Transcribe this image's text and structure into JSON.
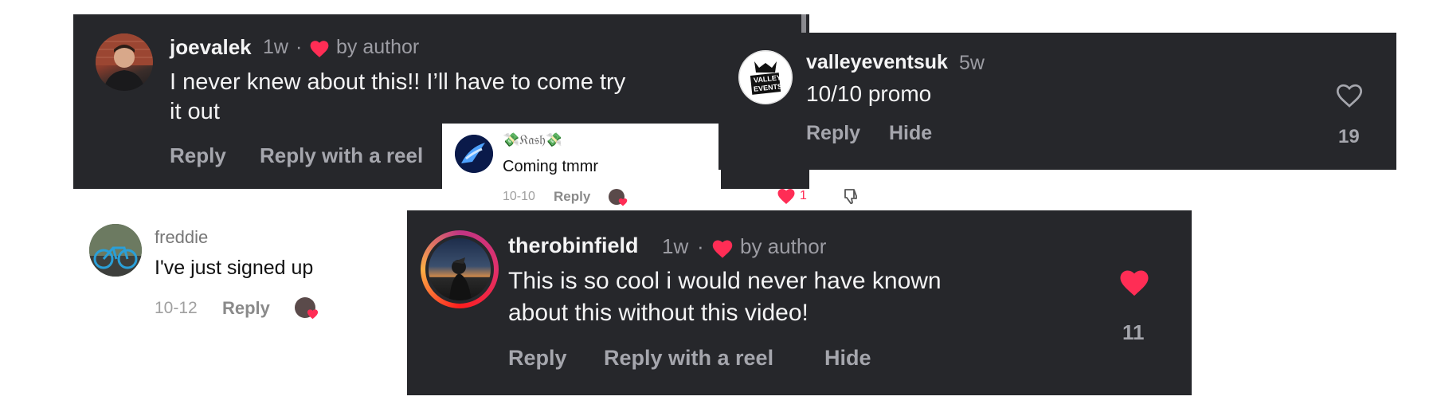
{
  "comments": {
    "joe": {
      "username": "joevalek",
      "time": "1w",
      "separator": "·",
      "author_badge": "by author",
      "text_line1": "I never knew about this!! I’ll have to come try",
      "text_line2": "it out",
      "reply": "Reply",
      "reply_reel": "Reply with a reel",
      "heart_icon": "heart-filled-icon",
      "heart_color": "#ff2d55"
    },
    "kash": {
      "username": "💸𝔎𝔞𝔰𝔥💸",
      "text": "Coming tmmr",
      "date": "10-10",
      "reply": "Reply",
      "like_count": "1",
      "icons": [
        "heart-filled-icon",
        "dislike-icon",
        "creator-liked-avatar"
      ]
    },
    "valley": {
      "username": "valleyeventsuk",
      "time": "5w",
      "text": "10/10 promo",
      "reply": "Reply",
      "hide": "Hide",
      "like_count": "19",
      "avatar_logo_line1": "VALLEY",
      "avatar_logo_line2": "EVENTS",
      "heart_icon": "heart-outline-icon"
    },
    "freddie": {
      "username": "freddie",
      "text": "I've just signed up",
      "date": "10-12",
      "reply": "Reply",
      "icons": [
        "creator-liked-avatar"
      ]
    },
    "robin": {
      "username": "therobinfield",
      "time": "1w",
      "separator": "·",
      "author_badge": "by author",
      "text_line1": "This is so cool i would never have known",
      "text_line2": "about this without this video!",
      "reply": "Reply",
      "reply_reel": "Reply with a reel",
      "hide": "Hide",
      "like_count": "11",
      "heart_icon": "heart-filled-icon",
      "story_ring_colors": [
        "#c13584",
        "#e1306c",
        "#fd1d1d",
        "#fcaf45"
      ]
    }
  },
  "colors": {
    "dark_bg": "#26272b",
    "muted_text": "#9c9ca3",
    "heart_red": "#ff2d55"
  }
}
